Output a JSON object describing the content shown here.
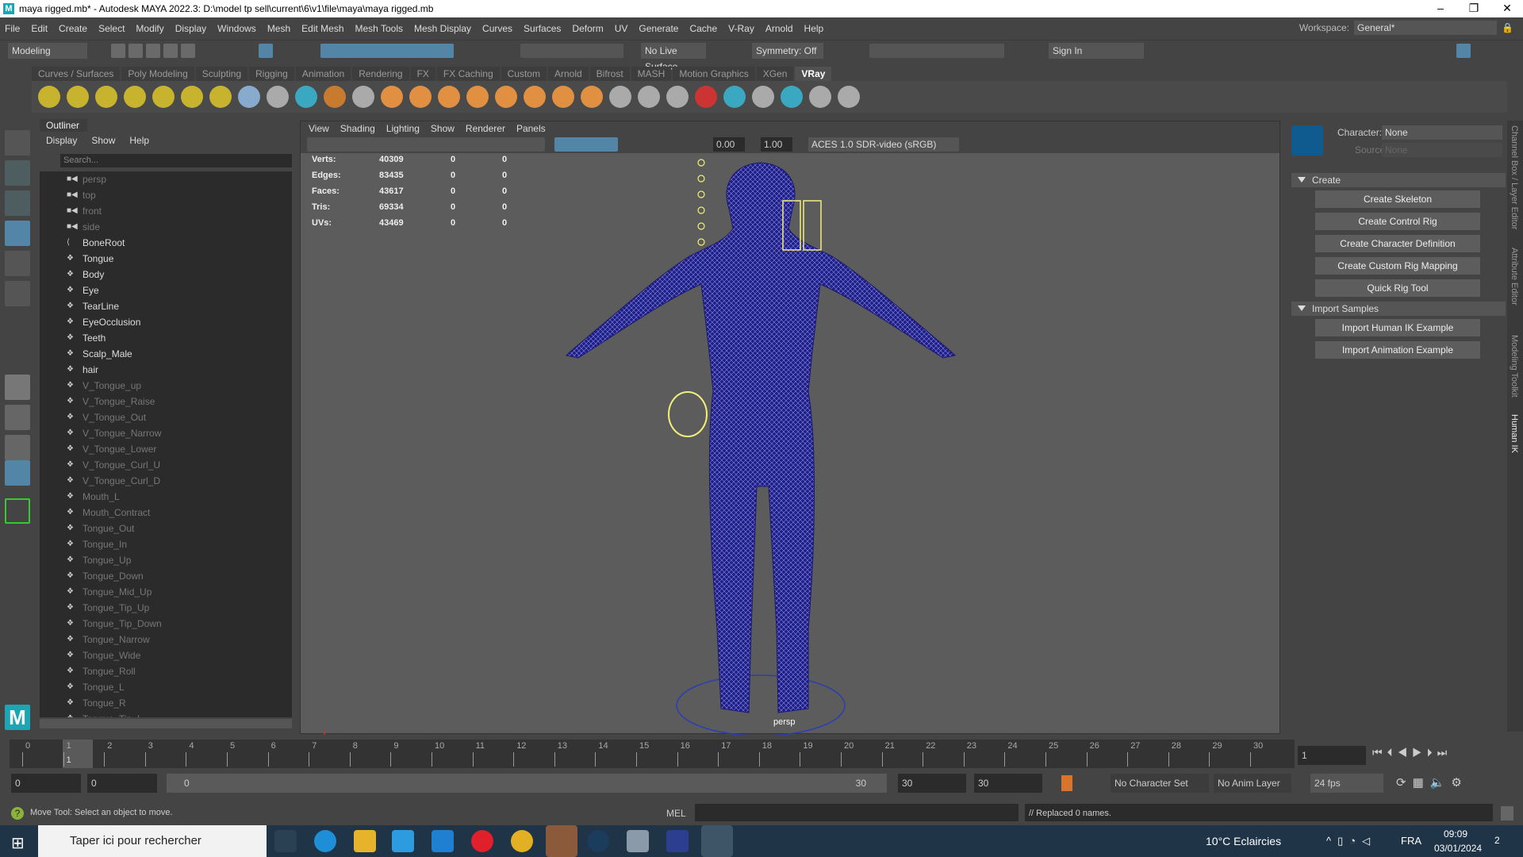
{
  "window": {
    "title": "maya rigged.mb* - Autodesk MAYA 2022.3: D:\\model tp sell\\current\\6\\v1\\file\\maya\\maya rigged.mb",
    "minimize": "–",
    "maximize": "❐",
    "close": "✕"
  },
  "menubar": [
    "File",
    "Edit",
    "Create",
    "Select",
    "Modify",
    "Display",
    "Windows",
    "Mesh",
    "Edit Mesh",
    "Mesh Tools",
    "Mesh Display",
    "Curves",
    "Surfaces",
    "Deform",
    "UV",
    "Generate",
    "Cache",
    "V-Ray",
    "Arnold",
    "Help"
  ],
  "workspace": {
    "label": "Workspace:",
    "value": "General*"
  },
  "statusline": {
    "menuset": "Modeling",
    "live_surface": "No Live Surface",
    "symmetry": "Symmetry: Off",
    "sign_in": "Sign In"
  },
  "shelf_tabs": [
    "Curves / Surfaces",
    "Poly Modeling",
    "Sculpting",
    "Rigging",
    "Animation",
    "Rendering",
    "FX",
    "FX Caching",
    "Custom",
    "Arnold",
    "Bifrost",
    "MASH",
    "Motion Graphics",
    "XGen",
    "VRay"
  ],
  "shelf_active": "VRay",
  "outliner": {
    "title": "Outliner",
    "menu": [
      "Display",
      "Show",
      "Help"
    ],
    "search_placeholder": "Search...",
    "items": [
      {
        "name": "persp",
        "type": "camera",
        "dim": true
      },
      {
        "name": "top",
        "type": "camera",
        "dim": true
      },
      {
        "name": "front",
        "type": "camera",
        "dim": true
      },
      {
        "name": "side",
        "type": "camera",
        "dim": true
      },
      {
        "name": "BoneRoot",
        "type": "joint",
        "dim": false
      },
      {
        "name": "Tongue",
        "type": "mesh",
        "dim": false
      },
      {
        "name": "Body",
        "type": "mesh",
        "dim": false
      },
      {
        "name": "Eye",
        "type": "mesh",
        "dim": false
      },
      {
        "name": "TearLine",
        "type": "mesh",
        "dim": false
      },
      {
        "name": "EyeOcclusion",
        "type": "mesh",
        "dim": false
      },
      {
        "name": "Teeth",
        "type": "mesh",
        "dim": false
      },
      {
        "name": "Scalp_Male",
        "type": "mesh",
        "dim": false
      },
      {
        "name": "hair",
        "type": "mesh",
        "dim": false
      },
      {
        "name": "V_Tongue_up",
        "type": "mesh",
        "dim": true
      },
      {
        "name": "V_Tongue_Raise",
        "type": "mesh",
        "dim": true
      },
      {
        "name": "V_Tongue_Out",
        "type": "mesh",
        "dim": true
      },
      {
        "name": "V_Tongue_Narrow",
        "type": "mesh",
        "dim": true
      },
      {
        "name": "V_Tongue_Lower",
        "type": "mesh",
        "dim": true
      },
      {
        "name": "V_Tongue_Curl_U",
        "type": "mesh",
        "dim": true
      },
      {
        "name": "V_Tongue_Curl_D",
        "type": "mesh",
        "dim": true
      },
      {
        "name": "Mouth_L",
        "type": "mesh",
        "dim": true
      },
      {
        "name": "Mouth_Contract",
        "type": "mesh",
        "dim": true
      },
      {
        "name": "Tongue_Out",
        "type": "mesh",
        "dim": true
      },
      {
        "name": "Tongue_In",
        "type": "mesh",
        "dim": true
      },
      {
        "name": "Tongue_Up",
        "type": "mesh",
        "dim": true
      },
      {
        "name": "Tongue_Down",
        "type": "mesh",
        "dim": true
      },
      {
        "name": "Tongue_Mid_Up",
        "type": "mesh",
        "dim": true
      },
      {
        "name": "Tongue_Tip_Up",
        "type": "mesh",
        "dim": true
      },
      {
        "name": "Tongue_Tip_Down",
        "type": "mesh",
        "dim": true
      },
      {
        "name": "Tongue_Narrow",
        "type": "mesh",
        "dim": true
      },
      {
        "name": "Tongue_Wide",
        "type": "mesh",
        "dim": true
      },
      {
        "name": "Tongue_Roll",
        "type": "mesh",
        "dim": true
      },
      {
        "name": "Tongue_L",
        "type": "mesh",
        "dim": true
      },
      {
        "name": "Tongue_R",
        "type": "mesh",
        "dim": true
      },
      {
        "name": "Tongue_Tip_L",
        "type": "mesh",
        "dim": true
      }
    ]
  },
  "viewport": {
    "menu": [
      "View",
      "Shading",
      "Lighting",
      "Show",
      "Renderer",
      "Panels"
    ],
    "exposure": "0.00",
    "gamma": "1.00",
    "color_space": "ACES 1.0 SDR-video (sRGB)",
    "camera_label": "persp",
    "hud": [
      [
        "Verts:",
        "40309",
        "0",
        "0"
      ],
      [
        "Edges:",
        "83435",
        "0",
        "0"
      ],
      [
        "Faces:",
        "43617",
        "0",
        "0"
      ],
      [
        "Tris:",
        "69334",
        "0",
        "0"
      ],
      [
        "UVs:",
        "43469",
        "0",
        "0"
      ]
    ]
  },
  "humanik": {
    "character_label": "Character:",
    "character_value": "None",
    "source_label": "Source:",
    "source_value": "None",
    "create_section": "Create",
    "create_buttons": [
      "Create Skeleton",
      "Create Control Rig",
      "Create Character Definition",
      "Create Custom Rig Mapping",
      "Quick Rig Tool"
    ],
    "import_section": "Import Samples",
    "import_buttons": [
      "Import Human IK Example",
      "Import Animation Example"
    ]
  },
  "side_tabs": [
    "Channel Box / Layer Editor",
    "Attribute Editor",
    "Modeling Toolkit",
    "Human IK"
  ],
  "timeline": {
    "ticks": [
      0,
      1,
      2,
      3,
      4,
      5,
      6,
      7,
      8,
      9,
      10,
      11,
      12,
      13,
      14,
      15,
      16,
      17,
      18,
      19,
      20,
      21,
      22,
      23,
      24,
      25,
      26,
      27,
      28,
      29,
      30
    ],
    "current_frame": "1",
    "current_field": "1"
  },
  "range": {
    "start": "0",
    "anim_start": "0",
    "slider_start": "0",
    "slider_end": "30",
    "anim_end": "30",
    "end": "30",
    "character_set": "No Character Set",
    "anim_layer": "No Anim Layer",
    "fps": "24 fps"
  },
  "helpline": {
    "text": "Move Tool: Select an object to move.",
    "mel_label": "MEL",
    "result": "// Replaced 0 names."
  },
  "taskbar": {
    "search": "Taper ici pour rechercher",
    "weather": "10°C  Eclaircies",
    "lang": "FRA",
    "time": "09:09",
    "date": "03/01/2024",
    "notif": "2"
  },
  "colors": {
    "accent": "#5285a6",
    "mesh": "#1d1d8c",
    "viewport": "#5c5c5c"
  }
}
